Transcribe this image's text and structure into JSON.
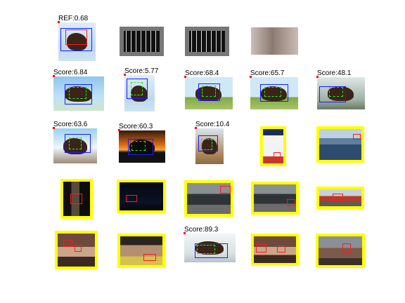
{
  "colors": {
    "highlight": "#ffff00",
    "detection_box": "#1a1aff",
    "match_box": "#ff1a1a",
    "keypoints": "#22ee22"
  },
  "rows": [
    {
      "name": "reference-row",
      "tiles": [
        {
          "label": "REF:0.68",
          "type": "horse-white",
          "highlighted": false
        },
        {
          "label": "",
          "type": "feature-map",
          "highlighted": false
        },
        {
          "label": "",
          "type": "feature-map",
          "highlighted": false
        },
        {
          "label": "",
          "type": "horse-blur",
          "highlighted": false
        }
      ]
    },
    {
      "name": "row-2",
      "tiles": [
        {
          "label": "Score:6.84",
          "type": "horse-sky",
          "highlighted": false
        },
        {
          "label": "Score:5.77",
          "type": "horse-white",
          "highlighted": false
        },
        {
          "label": "Score:68.4",
          "type": "horse-grass",
          "highlighted": false
        },
        {
          "label": "Score:65.7",
          "type": "horse-grass",
          "highlighted": false
        },
        {
          "label": "Score:48.1",
          "type": "horse-fog",
          "highlighted": false
        }
      ]
    },
    {
      "name": "row-3",
      "tiles": [
        {
          "label": "Score:63.6",
          "type": "horse-beach",
          "highlighted": false
        },
        {
          "label": "Score:60.3",
          "type": "horse-sunset",
          "highlighted": false
        },
        {
          "label": "Score:10.4",
          "type": "horse-portrait",
          "highlighted": false
        },
        {
          "label": "",
          "type": "poster",
          "highlighted": true
        },
        {
          "label": "",
          "type": "city-water",
          "highlighted": true
        }
      ]
    },
    {
      "name": "row-4",
      "tiles": [
        {
          "label": "",
          "type": "dark-room",
          "highlighted": true
        },
        {
          "label": "",
          "type": "night",
          "highlighted": true
        },
        {
          "label": "",
          "type": "car",
          "highlighted": true
        },
        {
          "label": "",
          "type": "car",
          "highlighted": true
        },
        {
          "label": "",
          "type": "red-car",
          "highlighted": true
        }
      ]
    },
    {
      "name": "row-5",
      "tiles": [
        {
          "label": "",
          "type": "people",
          "highlighted": true
        },
        {
          "label": "",
          "type": "person-flowers",
          "highlighted": true
        },
        {
          "label": "Score:89.3",
          "type": "horse-snow",
          "highlighted": false
        },
        {
          "label": "",
          "type": "people",
          "highlighted": true
        },
        {
          "label": "",
          "type": "group",
          "highlighted": true
        }
      ]
    }
  ]
}
